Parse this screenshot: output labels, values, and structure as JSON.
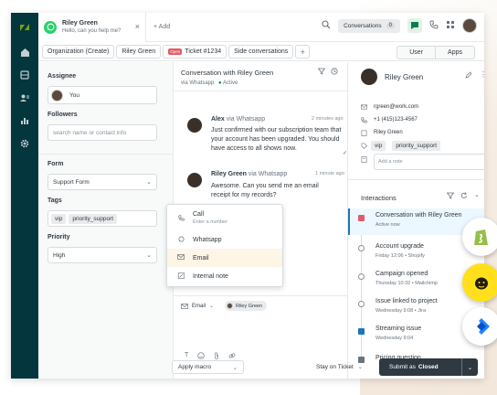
{
  "colors": {
    "rail": "#03363d",
    "whatsapp": "#25d366",
    "accent_green": "#038153",
    "open_badge": "#e35b66",
    "highlight_row": "#edf7ff",
    "submit": "#2f3941"
  },
  "tab": {
    "title": "Riley Green",
    "subtitle": "Hello, can you help me?",
    "close": "×",
    "add_label": "+ Add"
  },
  "topbar": {
    "conversations_label": "Conversations",
    "conversations_count": "0"
  },
  "crumbs": {
    "org": "Organization (Create)",
    "user": "Riley Green",
    "badge": "Open",
    "ticket": "Ticket #1234",
    "side": "Side conversations",
    "plus": "+"
  },
  "segment": {
    "user": "User",
    "apps": "Apps"
  },
  "left": {
    "assignee_label": "Assignee",
    "assignee_value": "You",
    "followers_label": "Followers",
    "followers_placeholder": "search name or contact info",
    "form_label": "Form",
    "form_value": "Support Form",
    "tags_label": "Tags",
    "tags": [
      "vip",
      "priority_support"
    ],
    "priority_label": "Priority",
    "priority_value": "High"
  },
  "conversation": {
    "title": "Conversation with Riley Green",
    "channel": "via Whatsapp",
    "status": "Active",
    "messages": [
      {
        "author": "Alex",
        "via": "via Whatsapp",
        "time": "2 minutes ago",
        "text": "Just confirmed with our subscription team that your account has been upgraded. You should have access to all shows now."
      },
      {
        "author": "Riley Green",
        "via": "via Whatsapp",
        "time": "1 minute ago",
        "text": "Awesome. Can you send me an email receipt for my records?"
      }
    ]
  },
  "channel_menu": {
    "items": [
      {
        "icon": "phone-icon",
        "label": "Call",
        "sub": "Enter a number"
      },
      {
        "icon": "whatsapp-icon",
        "label": "Whatsapp"
      },
      {
        "icon": "mail-icon",
        "label": "Email"
      },
      {
        "icon": "note-icon",
        "label": "Internal note"
      }
    ]
  },
  "composer": {
    "channel": "Email",
    "recipient": "Riley Green"
  },
  "footer": {
    "macro": "Apply macro",
    "stay": "Stay on Ticket",
    "submit_prefix": "Submit as",
    "submit_status": "Closed"
  },
  "profile": {
    "name": "Riley Green",
    "email": "rgreen@work.com",
    "phone": "+1 (415)123-4567",
    "org": "Riley Green",
    "tags": [
      "vip",
      "priority_support"
    ],
    "note_placeholder": "Add a note"
  },
  "interactions": {
    "title": "Interactions",
    "items": [
      {
        "title": "Conversation with Riley Green",
        "sub": "Active now"
      },
      {
        "title": "Account upgrade",
        "sub": "Friday 12:06 • Shopify"
      },
      {
        "title": "Campaign opened",
        "sub": "Thursday 10:32 • Mailchimp"
      },
      {
        "title": "Issue linked to project",
        "sub": "Wednesday 9:08 • Jira"
      },
      {
        "title": "Streaming issue",
        "sub": "Wednesday 9:04"
      },
      {
        "title": "Pricing question",
        "sub": ""
      }
    ]
  }
}
